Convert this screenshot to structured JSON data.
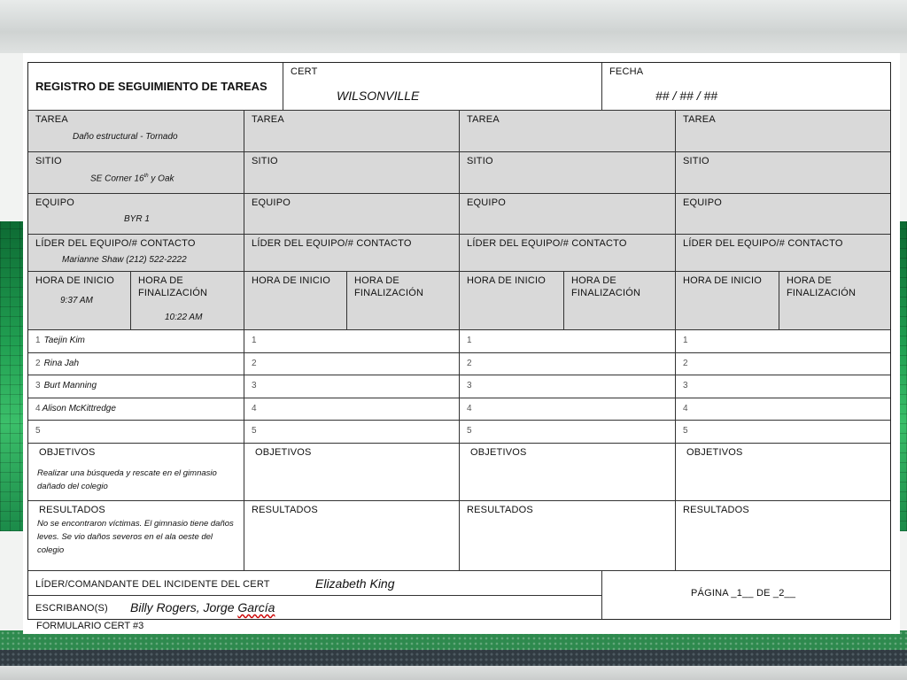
{
  "header": {
    "title": "REGISTRO DE SEGUIMIENTO DE TAREAS",
    "cert_label": "CERT",
    "cert_value": "WILSONVILLE",
    "fecha_label": "FECHA",
    "fecha_value": "## / ## / ##"
  },
  "labels": {
    "tarea": "TAREA",
    "sitio": "SITIO",
    "equipo": "EQUIPO",
    "lider": "LÍDER DEL EQUIPO/# CONTACTO",
    "hora_inicio": "HORA DE INICIO",
    "hora_fin_1": "HORA DE",
    "hora_fin_2": "FINALIZACIÓN",
    "objetivos": "OBJETIVOS",
    "resultados": "RESULTADOS",
    "nums": [
      "1",
      "2",
      "3",
      "4",
      "5"
    ]
  },
  "col1": {
    "tarea": "Daño estructural - Tornado",
    "sitio_pre": "SE Corner 16",
    "sitio_sup": "th",
    "sitio_post": " y Oak",
    "equipo": "BYR 1",
    "lider": "Marianne Shaw (212) 522-2222",
    "hora_inicio": "9:37 AM",
    "hora_fin": "10:22 AM",
    "members": [
      "Taejin Kim",
      "Rina Jah",
      "Burt Manning",
      "Alison McKittredge",
      ""
    ],
    "objetivos": "Realizar una búsqueda y rescate en el gimnasio dañado del colegio",
    "resultados": "No se encontraron víctimas.  El gimnasio tiene daños leves.  Se vio daños severos en el ala oeste del colegio"
  },
  "footer": {
    "commander_label": "LÍDER/COMANDANTE DEL INCIDENTE DEL CERT",
    "commander_value": "Elizabeth King",
    "scribe_label": "ESCRIBANO(S)",
    "scribe_value_1": "Billy Rogers, Jorge ",
    "scribe_value_2": "García",
    "pagina": "PÁGINA _1__ DE _2__",
    "form_id": "FORMULARIO CERT #3"
  }
}
